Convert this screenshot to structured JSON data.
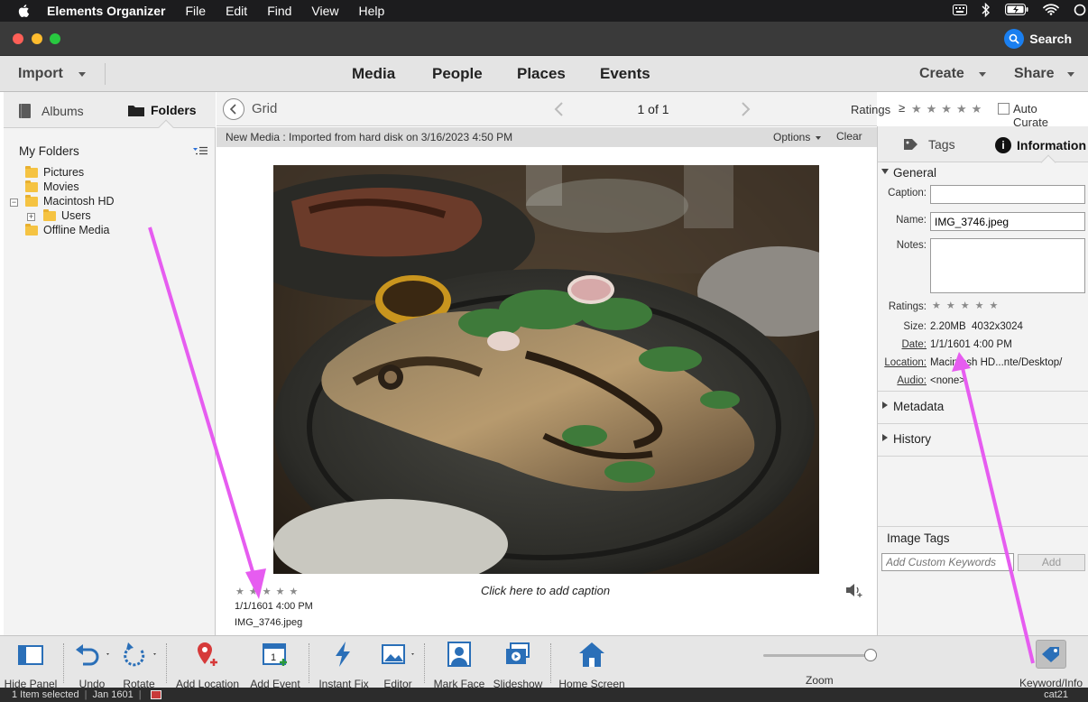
{
  "menubar": {
    "app_name": "Elements Organizer",
    "items": [
      "File",
      "Edit",
      "Find",
      "View",
      "Help"
    ]
  },
  "titlebar": {
    "search_label": "Search"
  },
  "navbar": {
    "import_label": "Import",
    "tabs": [
      "Media",
      "People",
      "Places",
      "Events"
    ],
    "create_label": "Create",
    "share_label": "Share"
  },
  "left_panel": {
    "tabs": {
      "albums": "Albums",
      "folders": "Folders"
    },
    "heading": "My Folders",
    "folders": {
      "pictures": "Pictures",
      "movies": "Movies",
      "macintosh_hd": "Macintosh HD",
      "users": "Users",
      "offline_media": "Offline Media"
    }
  },
  "grid_toolbar": {
    "view_label": "Grid",
    "page_counter": "1 of 1",
    "ratings_label": "Ratings",
    "ratings_operator": "≥",
    "auto_curate_label": "Auto Curate"
  },
  "info_bar": {
    "text": "New Media : Imported from hard disk on 3/16/2023 4:50 PM",
    "options_label": "Options",
    "clear_label": "Clear"
  },
  "media_item": {
    "caption_placeholder": "Click here to add caption",
    "date": "1/1/1601 4:00 PM",
    "filename": "IMG_3746.jpeg",
    "rating": 0,
    "max_rating": 5
  },
  "right_panel": {
    "tabs": {
      "tags": "Tags",
      "information": "Information"
    },
    "general": {
      "heading": "General",
      "caption_label": "Caption:",
      "caption_value": "",
      "name_label": "Name:",
      "name_value": "IMG_3746.jpeg",
      "notes_label": "Notes:",
      "notes_value": "",
      "ratings_label": "Ratings:",
      "size_label": "Size:",
      "size_value": "2.20MB  4032x3024",
      "date_label": "Date:",
      "date_value": "1/1/1601 4:00 PM",
      "location_label": "Location:",
      "location_value": "Macintosh HD...nte/Desktop/",
      "audio_label": "Audio:",
      "audio_value": "<none>"
    },
    "metadata_heading": "Metadata",
    "history_heading": "History",
    "image_tags": {
      "heading": "Image Tags",
      "keyword_placeholder": "Add Custom Keywords",
      "add_label": "Add"
    }
  },
  "bottom_toolbar": {
    "hide_panel": "Hide Panel",
    "undo": "Undo",
    "rotate": "Rotate",
    "add_location": "Add Location",
    "add_event": "Add Event",
    "instant_fix": "Instant Fix",
    "editor": "Editor",
    "mark_face": "Mark Face",
    "slideshow": "Slideshow",
    "home_screen": "Home Screen",
    "zoom_label": "Zoom",
    "zoom_level": 1.0,
    "keyword_info": "Keyword/Info"
  },
  "statusbar": {
    "selection": "1 Item selected",
    "date": "Jan 1601",
    "user": "cat21"
  },
  "colors": {
    "accent_blue": "#1a7ff0",
    "annotation_arrow": "#e65cf0"
  }
}
